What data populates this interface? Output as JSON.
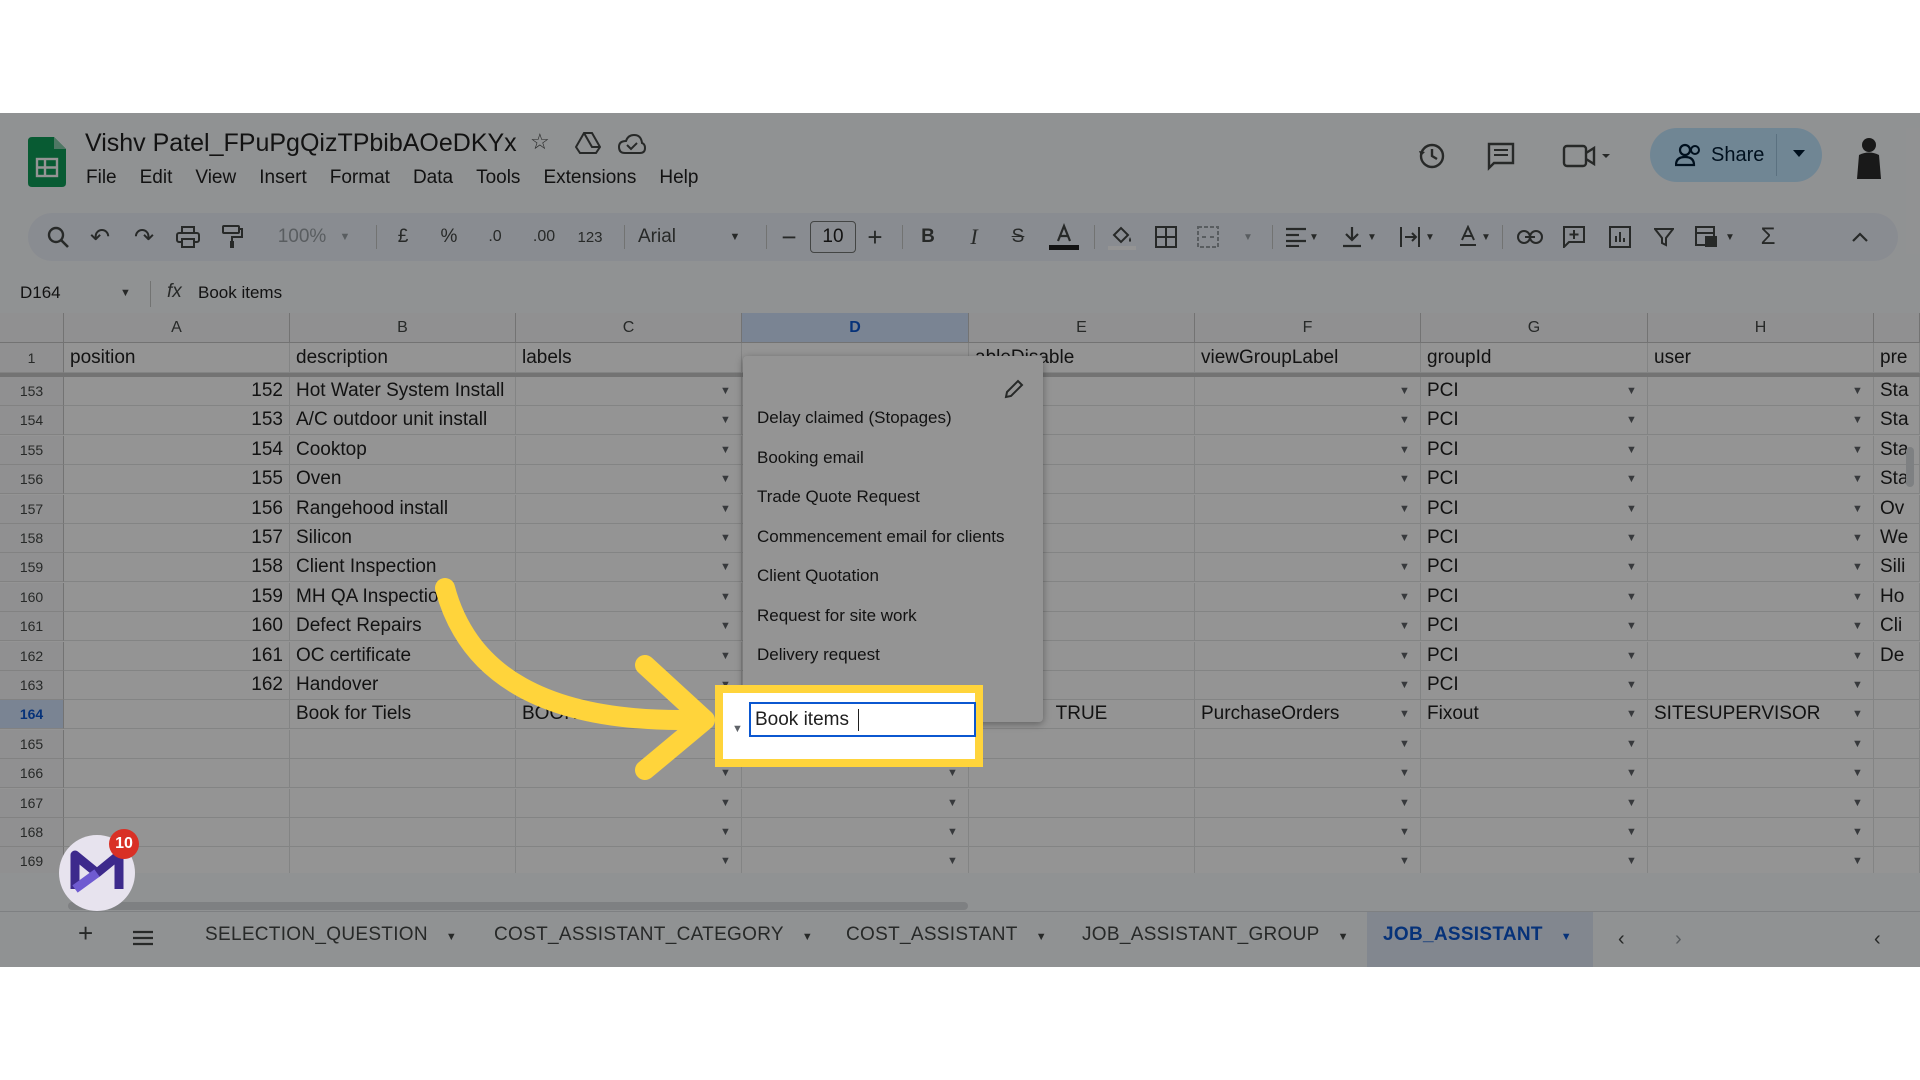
{
  "header": {
    "title": "Vishv Patel_FPuPgQizTPbibAOeDKYx",
    "menu": [
      "File",
      "Edit",
      "View",
      "Insert",
      "Format",
      "Data",
      "Tools",
      "Extensions",
      "Help"
    ],
    "share_label": "Share"
  },
  "toolbar": {
    "zoom": "100%",
    "currency": "£",
    "percent": "%",
    "dec_decrease": ".0",
    "dec_increase": ".00",
    "number_format": "123",
    "font": "Arial",
    "font_size": "10"
  },
  "formula_bar": {
    "cell_ref": "D164",
    "fx": "fx",
    "value": "Book items"
  },
  "grid": {
    "columns": [
      "A",
      "B",
      "C",
      "D",
      "E",
      "F",
      "G",
      "H"
    ],
    "header_row": {
      "row": "1",
      "cells": [
        "position",
        "description",
        "labels",
        "",
        "ableDisable",
        "viewGroupLabel",
        "groupId",
        "user",
        "pre"
      ]
    },
    "rows": [
      {
        "row": "153",
        "a": "152",
        "b": "Hot Water System Install",
        "c": "",
        "d": "",
        "e": "",
        "f": "",
        "g": "PCI",
        "h": "",
        "i": "Sta"
      },
      {
        "row": "154",
        "a": "153",
        "b": "A/C outdoor unit install",
        "c": "",
        "d": "",
        "e": "",
        "f": "",
        "g": "PCI",
        "h": "",
        "i": "Sta"
      },
      {
        "row": "155",
        "a": "154",
        "b": "Cooktop",
        "c": "",
        "d": "",
        "e": "",
        "f": "",
        "g": "PCI",
        "h": "",
        "i": "Sta"
      },
      {
        "row": "156",
        "a": "155",
        "b": "Oven",
        "c": "",
        "d": "",
        "e": "",
        "f": "",
        "g": "PCI",
        "h": "",
        "i": "Sta"
      },
      {
        "row": "157",
        "a": "156",
        "b": "Rangehood install",
        "c": "",
        "d": "",
        "e": "",
        "f": "",
        "g": "PCI",
        "h": "",
        "i": "Ov"
      },
      {
        "row": "158",
        "a": "157",
        "b": "Silicon",
        "c": "",
        "d": "",
        "e": "",
        "f": "",
        "g": "PCI",
        "h": "",
        "i": "We"
      },
      {
        "row": "159",
        "a": "158",
        "b": "Client Inspection",
        "c": "",
        "d": "",
        "e": "",
        "f": "",
        "g": "PCI",
        "h": "",
        "i": "Sili"
      },
      {
        "row": "160",
        "a": "159",
        "b": "MH QA Inspection",
        "c": "",
        "d": "",
        "e": "",
        "f": "",
        "g": "PCI",
        "h": "",
        "i": "Ho"
      },
      {
        "row": "161",
        "a": "160",
        "b": "Defect Repairs",
        "c": "",
        "d": "",
        "e": "",
        "f": "",
        "g": "PCI",
        "h": "",
        "i": "Cli"
      },
      {
        "row": "162",
        "a": "161",
        "b": "OC certificate",
        "c": "",
        "d": "",
        "e": "",
        "f": "",
        "g": "PCI",
        "h": "",
        "i": "De"
      },
      {
        "row": "163",
        "a": "162",
        "b": "Handover",
        "c": "",
        "d": "",
        "e": "",
        "f": "",
        "g": "PCI",
        "h": "",
        "i": ""
      },
      {
        "row": "164",
        "a": "",
        "b": "Book for Tiels",
        "c": "BOOKED",
        "d": "",
        "e": "TRUE",
        "f": "PurchaseOrders",
        "g": "Fixout",
        "h": "SITESUPERVISOR",
        "i": ""
      },
      {
        "row": "165",
        "a": "",
        "b": "",
        "c": "",
        "d": "",
        "e": "",
        "f": "",
        "g": "",
        "h": "",
        "i": ""
      },
      {
        "row": "166",
        "a": "",
        "b": "",
        "c": "",
        "d": "",
        "e": "",
        "f": "",
        "g": "",
        "h": "",
        "i": ""
      },
      {
        "row": "167",
        "a": "",
        "b": "",
        "c": "",
        "d": "",
        "e": "",
        "f": "",
        "g": "",
        "h": "",
        "i": ""
      },
      {
        "row": "168",
        "a": "",
        "b": "",
        "c": "",
        "d": "",
        "e": "",
        "f": "",
        "g": "",
        "h": "",
        "i": ""
      },
      {
        "row": "169",
        "a": "",
        "b": "",
        "c": "",
        "d": "",
        "e": "",
        "f": "",
        "g": "",
        "h": "",
        "i": ""
      }
    ],
    "editing_value": "Book items"
  },
  "dropdown_options": [
    "Delay claimed (Stopages)",
    "Booking email",
    "Trade Quote Request",
    "Commencement email for clients",
    "Client Quotation",
    "Request for site work",
    "Delivery request",
    "Book items"
  ],
  "tabs": [
    "SELECTION_QUESTION",
    "COST_ASSISTANT_CATEGORY",
    "COST_ASSISTANT",
    "JOB_ASSISTANT_GROUP",
    "JOB_ASSISTANT"
  ],
  "active_tab": "JOB_ASSISTANT",
  "badge_count": "10",
  "colors": {
    "accent": "#0b57d0",
    "highlight": "#ffd43b",
    "share_bg": "#c2e7ff",
    "sheets_green": "#0f9d58"
  }
}
